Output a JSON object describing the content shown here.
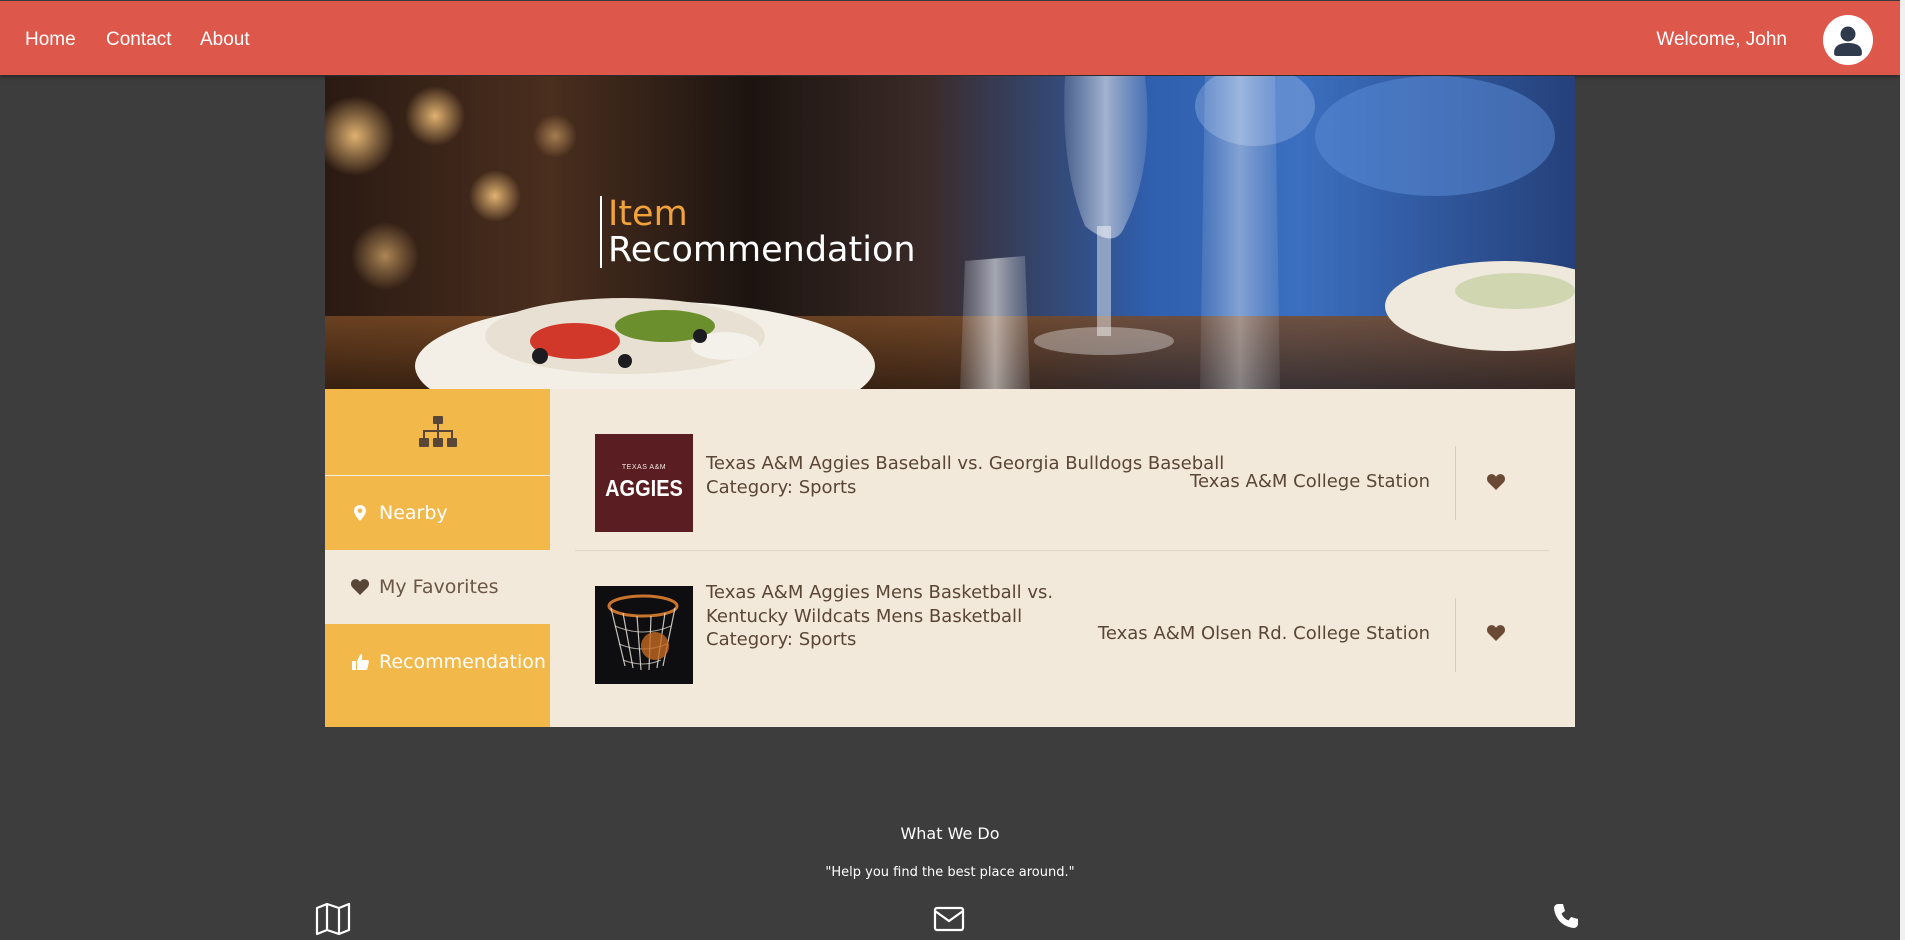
{
  "nav": {
    "links": [
      {
        "label": "Home"
      },
      {
        "label": "Contact"
      },
      {
        "label": "About"
      }
    ],
    "welcome": "Welcome, John"
  },
  "banner": {
    "title_line1": "Item",
    "title_line2": "Recommendation"
  },
  "sidebar": {
    "top_icon": "sitemap-icon",
    "items": [
      {
        "label": "Nearby",
        "icon": "map-marker-icon",
        "active": false
      },
      {
        "label": "My Favorites",
        "icon": "heart-icon",
        "active": true
      },
      {
        "label": "Recommendation",
        "icon": "thumbs-up-icon",
        "active": false
      }
    ]
  },
  "items": [
    {
      "name": "Texas A&M Aggies Baseball vs. Georgia Bulldogs Baseball",
      "category": "Category: Sports",
      "address": "Texas A&M College Station",
      "thumb_small": "TEXAS A&M",
      "thumb_big": "AGGIES"
    },
    {
      "name": "Texas A&M Aggies Mens Basketball vs. Kentucky Wildcats Mens Basketball",
      "category": "Category: Sports",
      "address": "Texas A&M Olsen Rd. College Station"
    }
  ],
  "footer": {
    "title": "What We Do",
    "quote": "\"Help you find the best place around.\"",
    "icons": [
      "map-icon",
      "envelope-icon",
      "phone-icon"
    ]
  },
  "colors": {
    "nav_bg": "#de574b",
    "sidebar_bg": "#f2b84a",
    "content_bg": "#f2e9da",
    "page_bg": "#3d3d3d",
    "title_accent": "#f2a23a",
    "text_brown": "#5a4636"
  }
}
